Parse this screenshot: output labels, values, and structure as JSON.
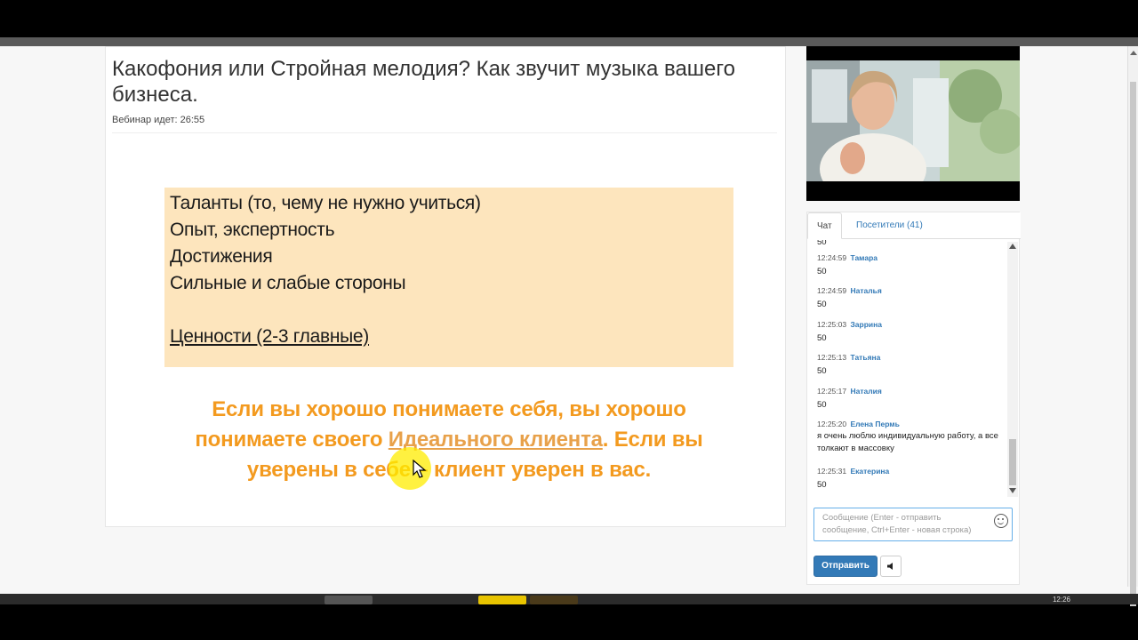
{
  "webinar": {
    "title": "Какофония или Стройная мелодия? Как звучит музыка вашего бизнеса.",
    "status": "Вебинар идет: 26:55"
  },
  "slide": {
    "lines": [
      "Таланты (то, чему не нужно учиться)",
      "Опыт, экспертность",
      "Достижения",
      "Сильные и слабые стороны",
      "Ценности (2-3 главные)"
    ],
    "quote_part1": "Если вы хорошо понимаете себя, вы хорошо понимаете своего ",
    "quote_highlight": "Идеального клиента",
    "quote_part2": ".  Если вы уверены в себе – клиент уверен в вас."
  },
  "chat": {
    "tabs": [
      "Чат",
      "Посетители (41)"
    ],
    "partial_top": "50",
    "messages": [
      {
        "time": "12:24:59",
        "author": "Тамара",
        "text": "50"
      },
      {
        "time": "12:24:59",
        "author": "Наталья",
        "text": "50"
      },
      {
        "time": "12:25:03",
        "author": "Заррина",
        "text": "50"
      },
      {
        "time": "12:25:13",
        "author": "Татьяна",
        "text": "50"
      },
      {
        "time": "12:25:17",
        "author": "Наталия",
        "text": "50"
      },
      {
        "time": "12:25:20",
        "author": "Елена Пермь",
        "text": "я очень люблю индивидуальную работу, а все толкают в массовку"
      },
      {
        "time": "12:25:31",
        "author": "Екатерина",
        "text": "50"
      }
    ],
    "input_placeholder": "Сообщение (Enter - отправить сообщение, Ctrl+Enter - новая строка)",
    "send_label": "Отправить"
  },
  "taskbar": {
    "clock": "12:26"
  },
  "colors": {
    "accent": "#337ab7",
    "slide_bg": "#fde5bd",
    "quote": "#f39a1f"
  }
}
